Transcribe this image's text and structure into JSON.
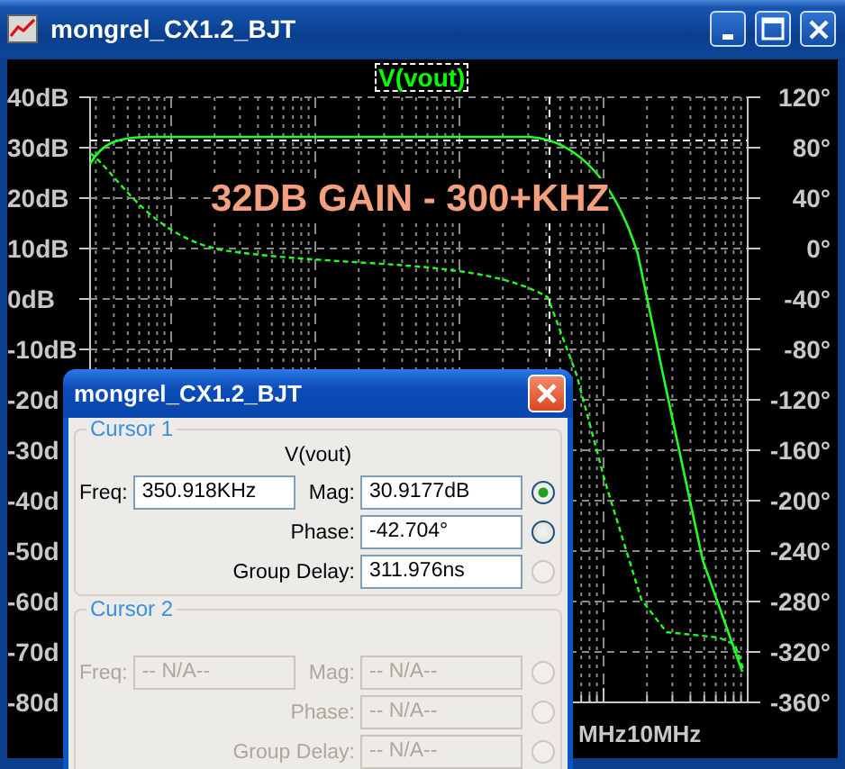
{
  "window": {
    "title": "mongrel_CX1.2_BJT"
  },
  "plot": {
    "trace_label": "V(vout)",
    "annotation": "32DB GAIN - 300+KHZ",
    "left_axis": [
      "40dB",
      "30dB",
      "20dB",
      "10dB",
      "0dB",
      "-10dB",
      "-20d",
      "-30d",
      "-40d",
      "-50d",
      "-60d",
      "-70d",
      "-80d"
    ],
    "right_axis": [
      "120°",
      "80°",
      "40°",
      "0°",
      "-40°",
      "-80°",
      "-120°",
      "-160°",
      "-200°",
      "-240°",
      "-280°",
      "-320°",
      "-360°"
    ],
    "x_axis": [
      "MHz",
      "10MHz"
    ]
  },
  "dialog": {
    "title": "mongrel_CX1.2_BJT",
    "groups": [
      {
        "title": "Cursor 1",
        "disabled": false,
        "trace": "V(vout)",
        "freq": {
          "label": "Freq:",
          "value": "350.918KHz"
        },
        "readouts": [
          {
            "label": "Mag:",
            "value": "30.9177dB",
            "selected": true,
            "disabled": false
          },
          {
            "label": "Phase:",
            "value": "-42.704°",
            "selected": false,
            "disabled": false
          },
          {
            "label": "Group Delay:",
            "value": "311.976ns",
            "selected": false,
            "disabled": true
          }
        ]
      },
      {
        "title": "Cursor 2",
        "disabled": true,
        "freq": {
          "label": "Freq:",
          "value": "-- N/A--"
        },
        "readouts": [
          {
            "label": "Mag:",
            "value": "-- N/A--",
            "selected": false,
            "disabled": true
          },
          {
            "label": "Phase:",
            "value": "-- N/A--",
            "selected": false,
            "disabled": true
          },
          {
            "label": "Group Delay:",
            "value": "-- N/A--",
            "selected": false,
            "disabled": true
          }
        ]
      }
    ]
  }
}
